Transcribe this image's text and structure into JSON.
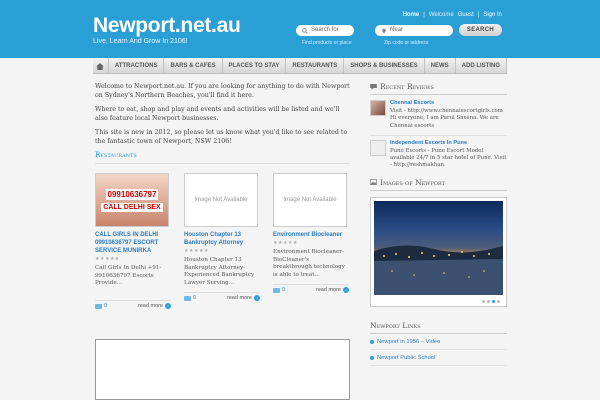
{
  "header": {
    "logo": "Newport.net.au",
    "tagline": "Live, Learn And Grow In 2106!",
    "toplinks": [
      "Home",
      "|",
      "Welcome",
      "Guest",
      "|",
      "Sign In"
    ],
    "search_placeholder": "Search for",
    "search_hint": "Find products or place",
    "near_placeholder": "Near",
    "near_hint": "Zip code or address",
    "search_button": "SEARCH"
  },
  "nav": {
    "items": [
      "ATTRACTIONS",
      "BARS & CAFES",
      "PLACES TO STAY",
      "RESTAURANTS",
      "SHOPS & BUSINESSES",
      "NEWS",
      "ADD LISTING"
    ]
  },
  "main": {
    "paragraphs": [
      "Welcome to Newport.net.au. If you are looking for anything to do with Newport on Sydney's Northern Beaches, you'll find it here.",
      "Where to eat, shop and play and events and activities will be listed and we'll also feature local Newport businesses.",
      "This site is new in 2012, so please let us know what you'd like to see related to the fantastic town of Newport, NSW 2106!"
    ],
    "section_title": "Restaurants",
    "cards": [
      {
        "thumb_line1": "09910636797",
        "thumb_line2": "CALL DELHI SEX",
        "title": "CALL GIRLS IN DELHI 09910636797 ESCORT SERVICE MUNIRKA",
        "stars": "★★★★★",
        "body": "Call Girls In Delhi +91-9910636797 Escorts Provide...",
        "comments": "0",
        "more": "read more"
      },
      {
        "thumb_text": "Image Not Available",
        "title": "Houston Chapter 13 Bankruptcy Attorney",
        "stars": "★★★★★",
        "body": "Houston Chapter 13 Bankruptcy Attorney-Experienced Bankruptcy Lawyer Serving...",
        "comments": "0",
        "more": "read more"
      },
      {
        "thumb_text": "Image Not Available",
        "title": "Environment Biocleaner",
        "stars": "★★★★★",
        "body": "Environment Biocleaner- BioCleaner's breakthrough technology is able to treat...",
        "comments": "0",
        "more": "read more"
      }
    ]
  },
  "sidebar": {
    "reviews_title": "Recent Reviews",
    "reviews": [
      {
        "title": "Chennai Escorts",
        "body": "Visit - http://www.chennaiescortgirls.com Hi everyone, I am Parul Saxena. We are Chennai escorts"
      },
      {
        "title": "Independent Escorts In Pune",
        "body": "Pune Escorts - Pune Escort Model available 24/7 in 5 star hotel of Pune. Visit - http://reshmakhan."
      }
    ],
    "images_title": "Images of Newport",
    "links_title": "Newport Links",
    "links": [
      "Newport in 1956 – Video",
      "Newport Public School"
    ]
  }
}
